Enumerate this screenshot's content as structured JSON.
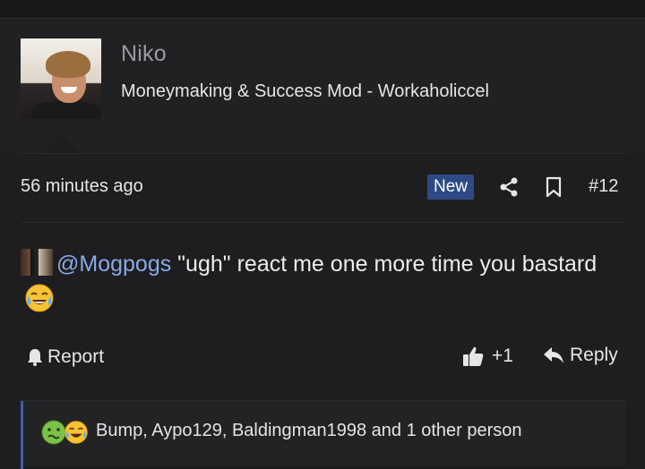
{
  "author": {
    "name": "Niko",
    "title": "Moneymaking & Success Mod - Workaholiccel"
  },
  "meta": {
    "timestamp": "56 minutes ago",
    "badge": "New",
    "post_number": "#12"
  },
  "content": {
    "mention": "@Mogpogs",
    "text_part1": " \"ugh\" react me one more time you bastard"
  },
  "actions": {
    "report": "Report",
    "like_count": "+1",
    "reply": "Reply"
  },
  "reactions": {
    "summary": "Bump, Aypo129, Baldingman1998 and 1 other person"
  },
  "colors": {
    "accent_blue": "#2d4a86",
    "mention": "#8aa9e6",
    "background": "#1e1e20"
  }
}
